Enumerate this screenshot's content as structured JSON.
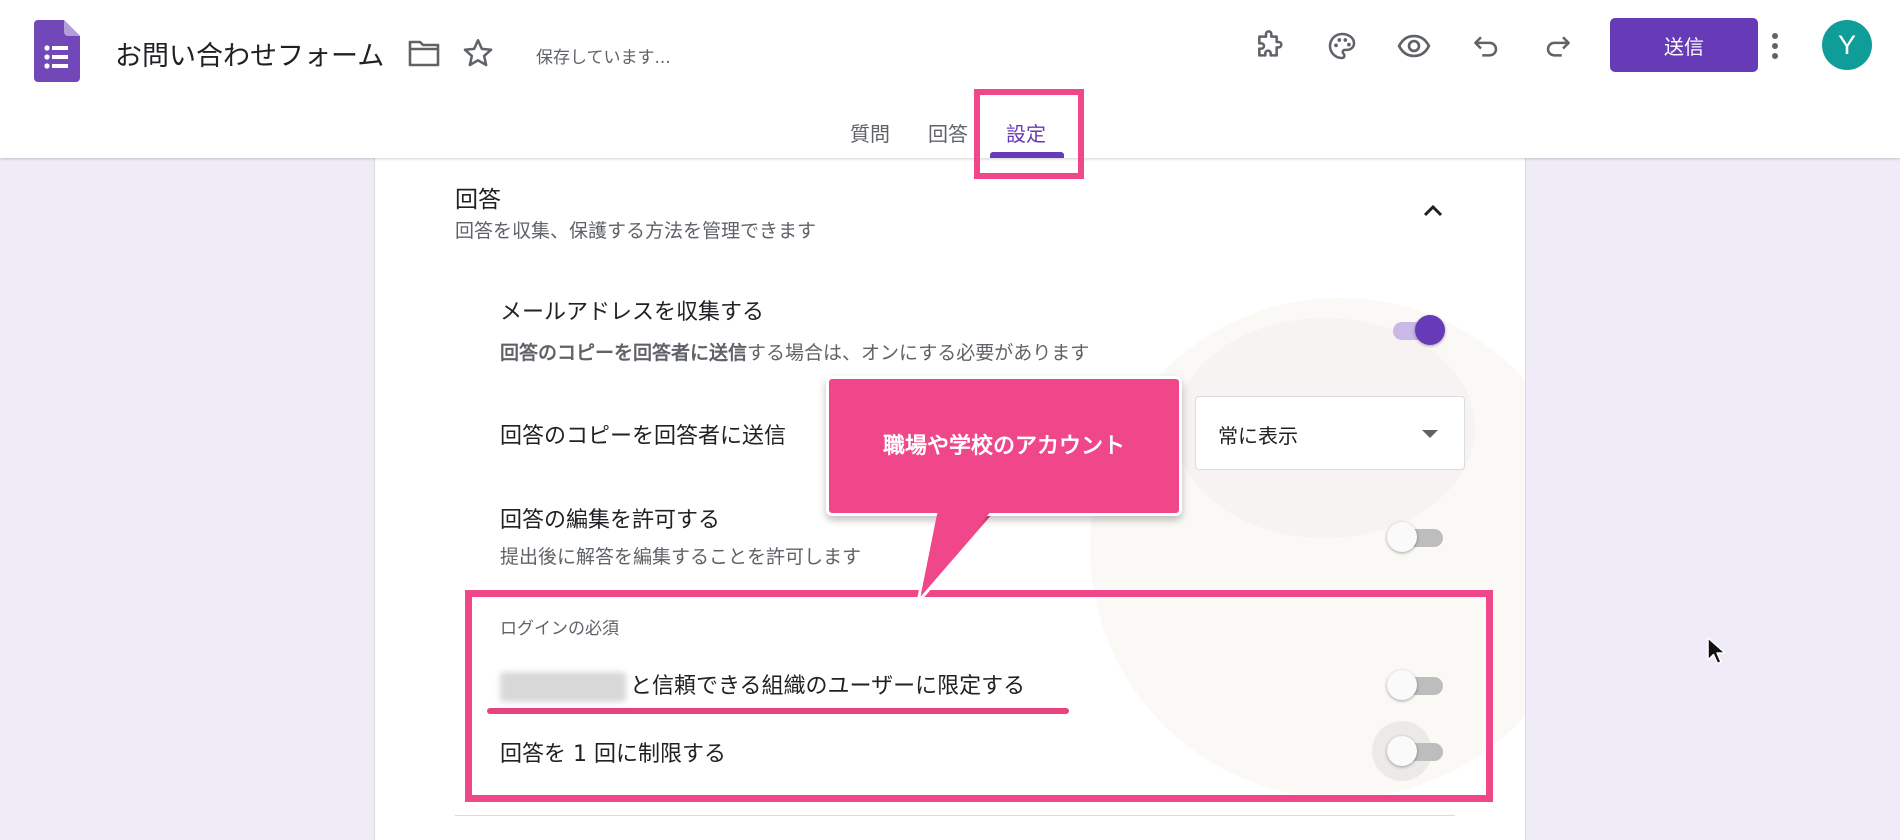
{
  "header": {
    "doc_title": "お問い合わせフォーム",
    "saving_status": "保存しています...",
    "send_label": "送信",
    "avatar_letter": "Y",
    "icons": [
      "folder-icon",
      "star-icon",
      "addon-icon",
      "palette-icon",
      "preview-eye-icon",
      "undo-icon",
      "redo-icon",
      "more-vert-icon"
    ],
    "accent_color": "#673ab7",
    "avatar_color": "#0f9d9a"
  },
  "tabs": [
    {
      "label": "質問",
      "active": false
    },
    {
      "label": "回答",
      "active": false
    },
    {
      "label": "設定",
      "active": true
    }
  ],
  "responses_section": {
    "title": "回答",
    "description": "回答を収集、保護する方法を管理できます",
    "collect_email": {
      "title": "メールアドレスを収集する",
      "desc_bold": "回答のコピーを回答者に送信",
      "desc_rest": "する場合は、オンにする必要があります",
      "enabled": true
    },
    "send_copy": {
      "title": "回答のコピーを回答者に送信",
      "selected": "常に表示"
    },
    "allow_edit": {
      "title": "回答の編集を許可する",
      "description": "提出後に解答を編集することを許可します",
      "enabled": false
    },
    "login_required": {
      "subheader": "ログインの必須",
      "restrict_label": "と信頼できる組織のユーザーに限定する",
      "restrict_enabled": false,
      "limit_one_label": "回答を 1 回に制限する",
      "limit_one_enabled": false
    }
  },
  "annotation": {
    "callout_text": "職場や学校のアカウント",
    "highlight_color": "#f0468a"
  }
}
